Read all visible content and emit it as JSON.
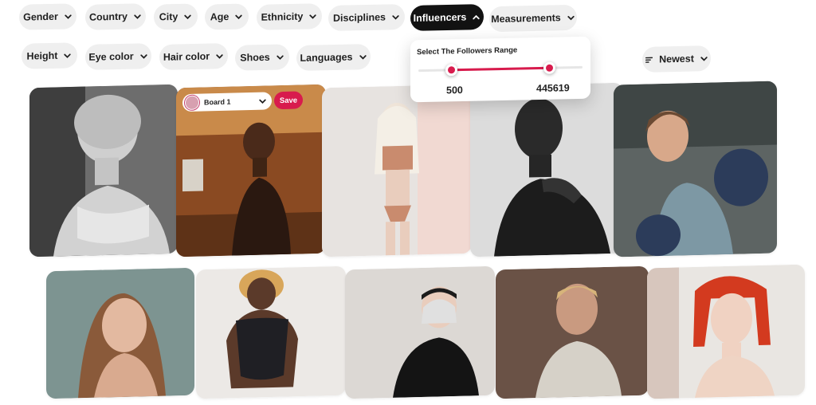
{
  "filters": {
    "row1": [
      {
        "label": "Gender",
        "icon": "chevron-down-icon"
      },
      {
        "label": "Country",
        "icon": "chevron-down-icon"
      },
      {
        "label": "City",
        "icon": "chevron-down-icon"
      },
      {
        "label": "Age",
        "icon": "chevron-down-icon"
      },
      {
        "label": "Ethnicity",
        "icon": "chevron-down-icon"
      },
      {
        "label": "Disciplines",
        "icon": "chevron-down-icon"
      },
      {
        "label": "Influencers",
        "icon": "chevron-up-icon",
        "active": true
      },
      {
        "label": "Measurements",
        "icon": "chevron-down-icon"
      }
    ],
    "row2": [
      {
        "label": "Height",
        "icon": "chevron-down-icon"
      },
      {
        "label": "Eye color",
        "icon": "chevron-down-icon"
      },
      {
        "label": "Hair color",
        "icon": "chevron-down-icon"
      },
      {
        "label": "Shoes",
        "icon": "chevron-down-icon"
      },
      {
        "label": "Languages",
        "icon": "chevron-down-icon"
      }
    ]
  },
  "sort": {
    "label": "Newest",
    "icon": "sort-lines-icon"
  },
  "followers_popup": {
    "title": "Select The Followers Range",
    "min_value": "500",
    "max_value": "445619",
    "slider_low_fraction": 0.2,
    "slider_high_fraction": 0.8
  },
  "board_overlay": {
    "board_label": "Board 1",
    "save_label": "Save"
  },
  "colors": {
    "accent": "#d81b4d",
    "active_chip": "#121212",
    "chip_bg": "#efefef"
  }
}
